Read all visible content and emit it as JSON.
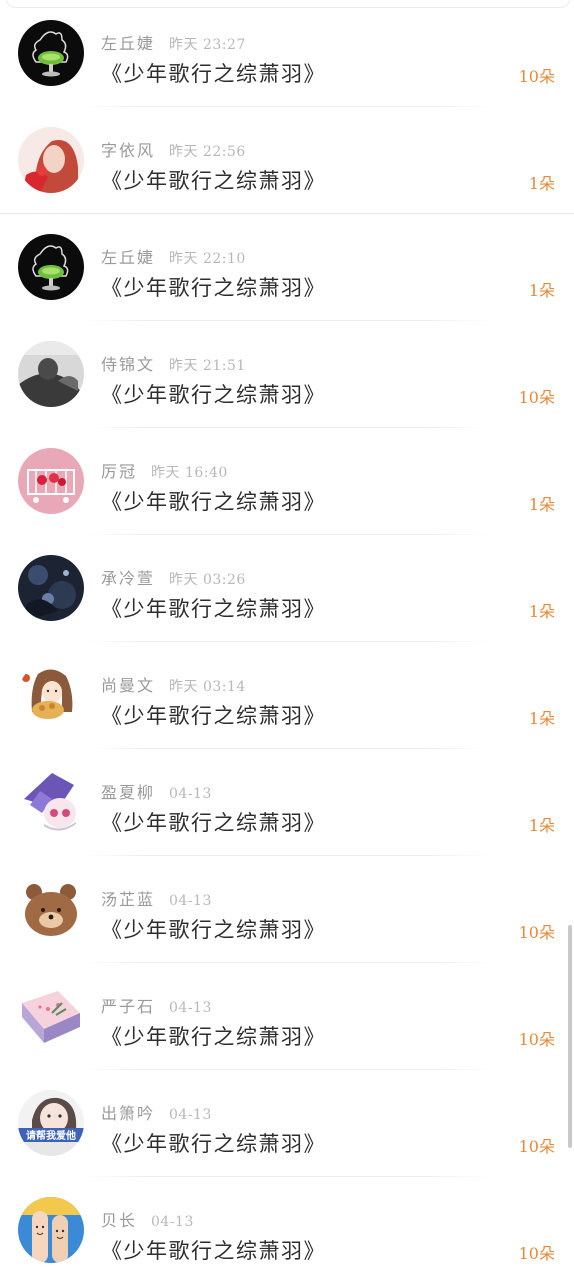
{
  "gift_records": [
    {
      "name": "左丘婕",
      "time": "昨天  23:27",
      "gift": "《少年歌行之综萧羽》",
      "count": "10朵",
      "avatar": "rooster-glass-avatar"
    },
    {
      "name": "字依风",
      "time": "昨天  22:56",
      "gift": "《少年歌行之综萧羽》",
      "count": "1朵",
      "avatar": "red-hair-girl-avatar"
    },
    {
      "name": "左丘婕",
      "time": "昨天  22:10",
      "gift": "《少年歌行之综萧羽》",
      "count": "1朵",
      "avatar": "rooster-glass-avatar"
    },
    {
      "name": "侍锦文",
      "time": "昨天  21:51",
      "gift": "《少年歌行之综萧羽》",
      "count": "10朵",
      "avatar": "grayscale-man-avatar"
    },
    {
      "name": "厉冠",
      "time": "昨天  16:40",
      "gift": "《少年歌行之综萧羽》",
      "count": "1朵",
      "avatar": "pink-cart-avatar"
    },
    {
      "name": "承冷萱",
      "time": "昨天  03:26",
      "gift": "《少年歌行之综萧羽》",
      "count": "1朵",
      "avatar": "dark-blue-night-avatar"
    },
    {
      "name": "尚曼文",
      "time": "昨天  03:14",
      "gift": "《少年歌行之综萧羽》",
      "count": "1朵",
      "avatar": "cartoon-girl-food-avatar"
    },
    {
      "name": "盈夏柳",
      "time": "04-13",
      "gift": "《少年歌行之综萧羽》",
      "count": "1朵",
      "avatar": "anime-purple-hat-avatar"
    },
    {
      "name": "汤芷蓝",
      "time": "04-13",
      "gift": "《少年歌行之综萧羽》",
      "count": "10朵",
      "avatar": "brown-bear-avatar"
    },
    {
      "name": "严子石",
      "time": "04-13",
      "gift": "《少年歌行之综萧羽》",
      "count": "10朵",
      "avatar": "gift-box-avatar"
    },
    {
      "name": "出箫吟",
      "time": "04-13",
      "gift": "《少年歌行之综萧羽》",
      "count": "10朵",
      "avatar": "girl-banner-avatar"
    },
    {
      "name": "贝长",
      "time": "04-13",
      "gift": "《少年歌行之综萧羽》",
      "count": "10朵",
      "avatar": "finger-faces-avatar"
    }
  ],
  "avatar_texts": {
    "girl_banner": "请帮我爱他"
  },
  "colors": {
    "count_orange": "#e58a3c",
    "name_gray": "#9a9a9a",
    "time_gray": "#b8b8b8",
    "gift_text": "#2d2d2d"
  }
}
